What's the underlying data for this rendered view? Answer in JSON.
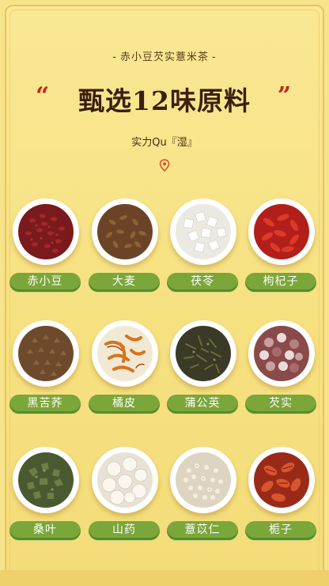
{
  "header": {
    "subtitle": "赤小豆芡实薏米茶",
    "quote_open": "“",
    "headline": "甄选12味原料",
    "quote_close": "”",
    "tagline": "实力Qu『湿』"
  },
  "ingredients": [
    {
      "label": "赤小豆",
      "icon": "red-bean-icon"
    },
    {
      "label": "大麦",
      "icon": "barley-icon"
    },
    {
      "label": "茯苓",
      "icon": "poria-icon"
    },
    {
      "label": "枸杞子",
      "icon": "goji-icon"
    },
    {
      "label": "黑苦荞",
      "icon": "buckwheat-icon"
    },
    {
      "label": "橘皮",
      "icon": "orange-peel-icon"
    },
    {
      "label": "蒲公英",
      "icon": "dandelion-icon"
    },
    {
      "label": "芡实",
      "icon": "euryale-icon"
    },
    {
      "label": "桑叶",
      "icon": "mulberry-leaf-icon"
    },
    {
      "label": "山药",
      "icon": "yam-icon"
    },
    {
      "label": "薏苡仁",
      "icon": "coix-seed-icon"
    },
    {
      "label": "栀子",
      "icon": "gardenia-icon"
    }
  ],
  "colors": {
    "background": "#f7e38a",
    "label_green": "#7ba63a",
    "quote_red": "#c7261e",
    "headline_brown": "#3b1f10"
  }
}
